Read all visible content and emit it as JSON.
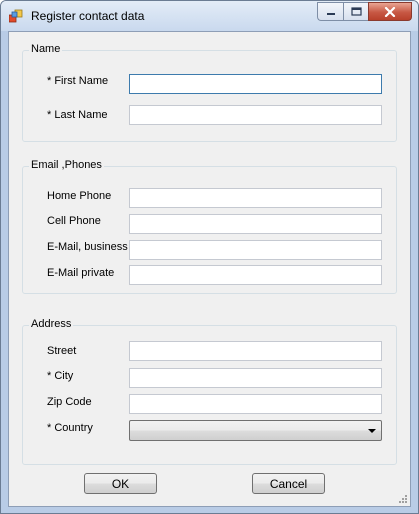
{
  "window": {
    "title": "Register contact data",
    "icon": "app-form-icon",
    "caption": {
      "minimize_icon": "minimize-icon",
      "maximize_icon": "maximize-icon",
      "close_icon": "close-icon"
    }
  },
  "groups": {
    "name": {
      "title": "Name",
      "fields": [
        {
          "label": "* First Name",
          "value": ""
        },
        {
          "label": "* Last Name",
          "value": ""
        }
      ]
    },
    "contact": {
      "title": "Email ,Phones",
      "fields": [
        {
          "label": "Home Phone",
          "value": ""
        },
        {
          "label": "Cell Phone",
          "value": ""
        },
        {
          "label": "E-Mail, business",
          "value": ""
        },
        {
          "label": "E-Mail private",
          "value": ""
        }
      ]
    },
    "address": {
      "title": "Address",
      "fields": [
        {
          "label": "Street",
          "value": ""
        },
        {
          "label": "* City",
          "value": ""
        },
        {
          "label": "Zip Code",
          "value": ""
        },
        {
          "label": "* Country",
          "value": ""
        }
      ]
    }
  },
  "buttons": {
    "ok": "OK",
    "cancel": "Cancel"
  },
  "colors": {
    "title_bar": "#c9d9ee",
    "client_bg": "#f0f0f0",
    "focus_border": "#3d7bad",
    "close_button": "#c75844"
  }
}
